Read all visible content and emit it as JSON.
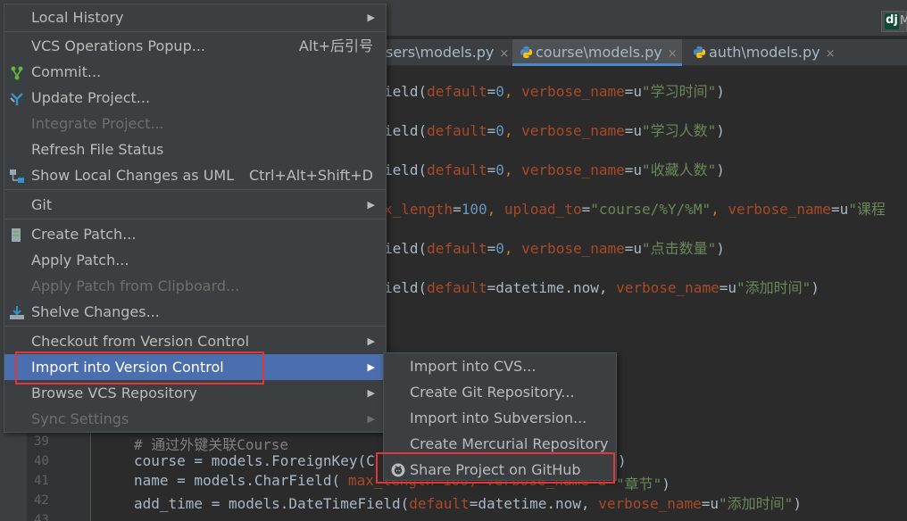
{
  "editor": {
    "tabs": [
      {
        "label": "sers\\models.py",
        "active": false
      },
      {
        "label": "course\\models.py",
        "active": true
      },
      {
        "label": "auth\\models.py",
        "active": false
      }
    ],
    "close_glyph": "×",
    "project_badge": {
      "logo": "dj",
      "letter": "M"
    },
    "line_numbers": [
      "39",
      "40",
      "41",
      "42",
      "43"
    ],
    "code_lines": [
      {
        "p1": "ield(",
        "kw": "default",
        "p2": "=",
        "num": "0",
        "p3": ", ",
        "kw2": "verbose_name",
        "p4": "=u",
        "str": "\"学习时间\"",
        "p5": ")"
      },
      {
        "p1": "ield(",
        "kw": "default",
        "p2": "=",
        "num": "0",
        "p3": ", ",
        "kw2": "verbose_name",
        "p4": "=u",
        "str": "\"学习人数\"",
        "p5": ")"
      },
      {
        "p1": "ield(",
        "kw": "default",
        "p2": "=",
        "num": "0",
        "p3": ", ",
        "kw2": "verbose_name",
        "p4": "=u",
        "str": "\"收藏人数\"",
        "p5": ")"
      },
      {
        "p1": "x_length",
        "kw": "",
        "p2": "=",
        "num": "100",
        "p3": ", ",
        "kw2": "upload_to",
        "p4": "=",
        "str": "\"course/%Y/%M\"",
        "p5": ", ",
        "kw3": "verbose_name",
        "p6": "=u",
        "str2": "\"课程"
      },
      {
        "p1": "ield(",
        "kw": "default",
        "p2": "=",
        "num": "0",
        "p3": ", ",
        "kw2": "verbose_name",
        "p4": "=u",
        "str": "\"点击数量\"",
        "p5": ")"
      },
      {
        "p1": "ield(",
        "kw": "default",
        "p2": "=datetime.now, ",
        "num": "",
        "p3": "",
        "kw2": "verbose_name",
        "p4": "=u",
        "str": "\"添加时间\"",
        "p5": ")"
      }
    ],
    "bottom_code": {
      "comment": "# 通过外键关联Course",
      "line40_a": "course = models.ForeignKey(",
      "line40_b": "C",
      "line40_c": ")",
      "line41_a": "name = models.CharField(",
      "line41_b": "max_length=100, verbose_name=u",
      "line41_c": "\"章节\"",
      "line41_d": ")",
      "line42_a": "add_time = models.DateTimeField(",
      "line42_kw": "default",
      "line42_b": "=datetime.now, ",
      "line42_kw2": "verbose_name",
      "line42_c": "=u",
      "line42_str": "\"添加时间\"",
      "line42_d": ")"
    }
  },
  "vcs_menu": {
    "items": [
      {
        "id": "local-history",
        "label": "Local History",
        "submenu": true,
        "disabled": false
      },
      {
        "id": "vcs-operations-popup",
        "label": "VCS Operations Popup...",
        "shortcut": "Alt+后引号",
        "disabled": false
      },
      {
        "id": "commit",
        "label": "Commit...",
        "icon": "commit-icon",
        "disabled": false
      },
      {
        "id": "update-project",
        "label": "Update Project...",
        "icon": "update-icon",
        "disabled": false
      },
      {
        "id": "integrate-project",
        "label": "Integrate Project...",
        "disabled": true
      },
      {
        "id": "refresh-file-status",
        "label": "Refresh File Status",
        "disabled": false
      },
      {
        "id": "show-local-changes-uml",
        "label": "Show Local Changes as UML",
        "shortcut": "Ctrl+Alt+Shift+D",
        "icon": "uml-icon",
        "disabled": false
      },
      {
        "id": "git",
        "label": "Git",
        "submenu": true,
        "disabled": false
      },
      {
        "id": "create-patch",
        "label": "Create Patch...",
        "icon": "patch-icon",
        "disabled": false
      },
      {
        "id": "apply-patch",
        "label": "Apply Patch...",
        "disabled": false
      },
      {
        "id": "apply-patch-clipboard",
        "label": "Apply Patch from Clipboard...",
        "disabled": true
      },
      {
        "id": "shelve-changes",
        "label": "Shelve Changes...",
        "icon": "shelve-icon",
        "disabled": false
      },
      {
        "id": "checkout-from-vcs",
        "label": "Checkout from Version Control",
        "submenu": true,
        "disabled": false
      },
      {
        "id": "import-into-vcs",
        "label": "Import into Version Control",
        "submenu": true,
        "selected": true,
        "disabled": false
      },
      {
        "id": "browse-vcs-repository",
        "label": "Browse VCS Repository",
        "submenu": true,
        "disabled": false
      },
      {
        "id": "sync-settings",
        "label": "Sync Settings",
        "submenu": true,
        "disabled": true
      }
    ],
    "arrow_glyph": "▶"
  },
  "import_submenu": {
    "items": [
      {
        "id": "import-into-cvs",
        "label": "Import into CVS..."
      },
      {
        "id": "create-git-repository",
        "label": "Create Git Repository..."
      },
      {
        "id": "import-into-subversion",
        "label": "Import into Subversion..."
      },
      {
        "id": "create-mercurial-repository",
        "label": "Create Mercurial Repository"
      },
      {
        "id": "share-project-on-github",
        "label": "Share Project on GitHub",
        "icon": "github-icon"
      }
    ]
  },
  "colors": {
    "menu_bg": "#3c3f41",
    "selection": "#4b6eaf",
    "highlight_border": "#e0373c",
    "editor_bg": "#2b2b2b"
  }
}
